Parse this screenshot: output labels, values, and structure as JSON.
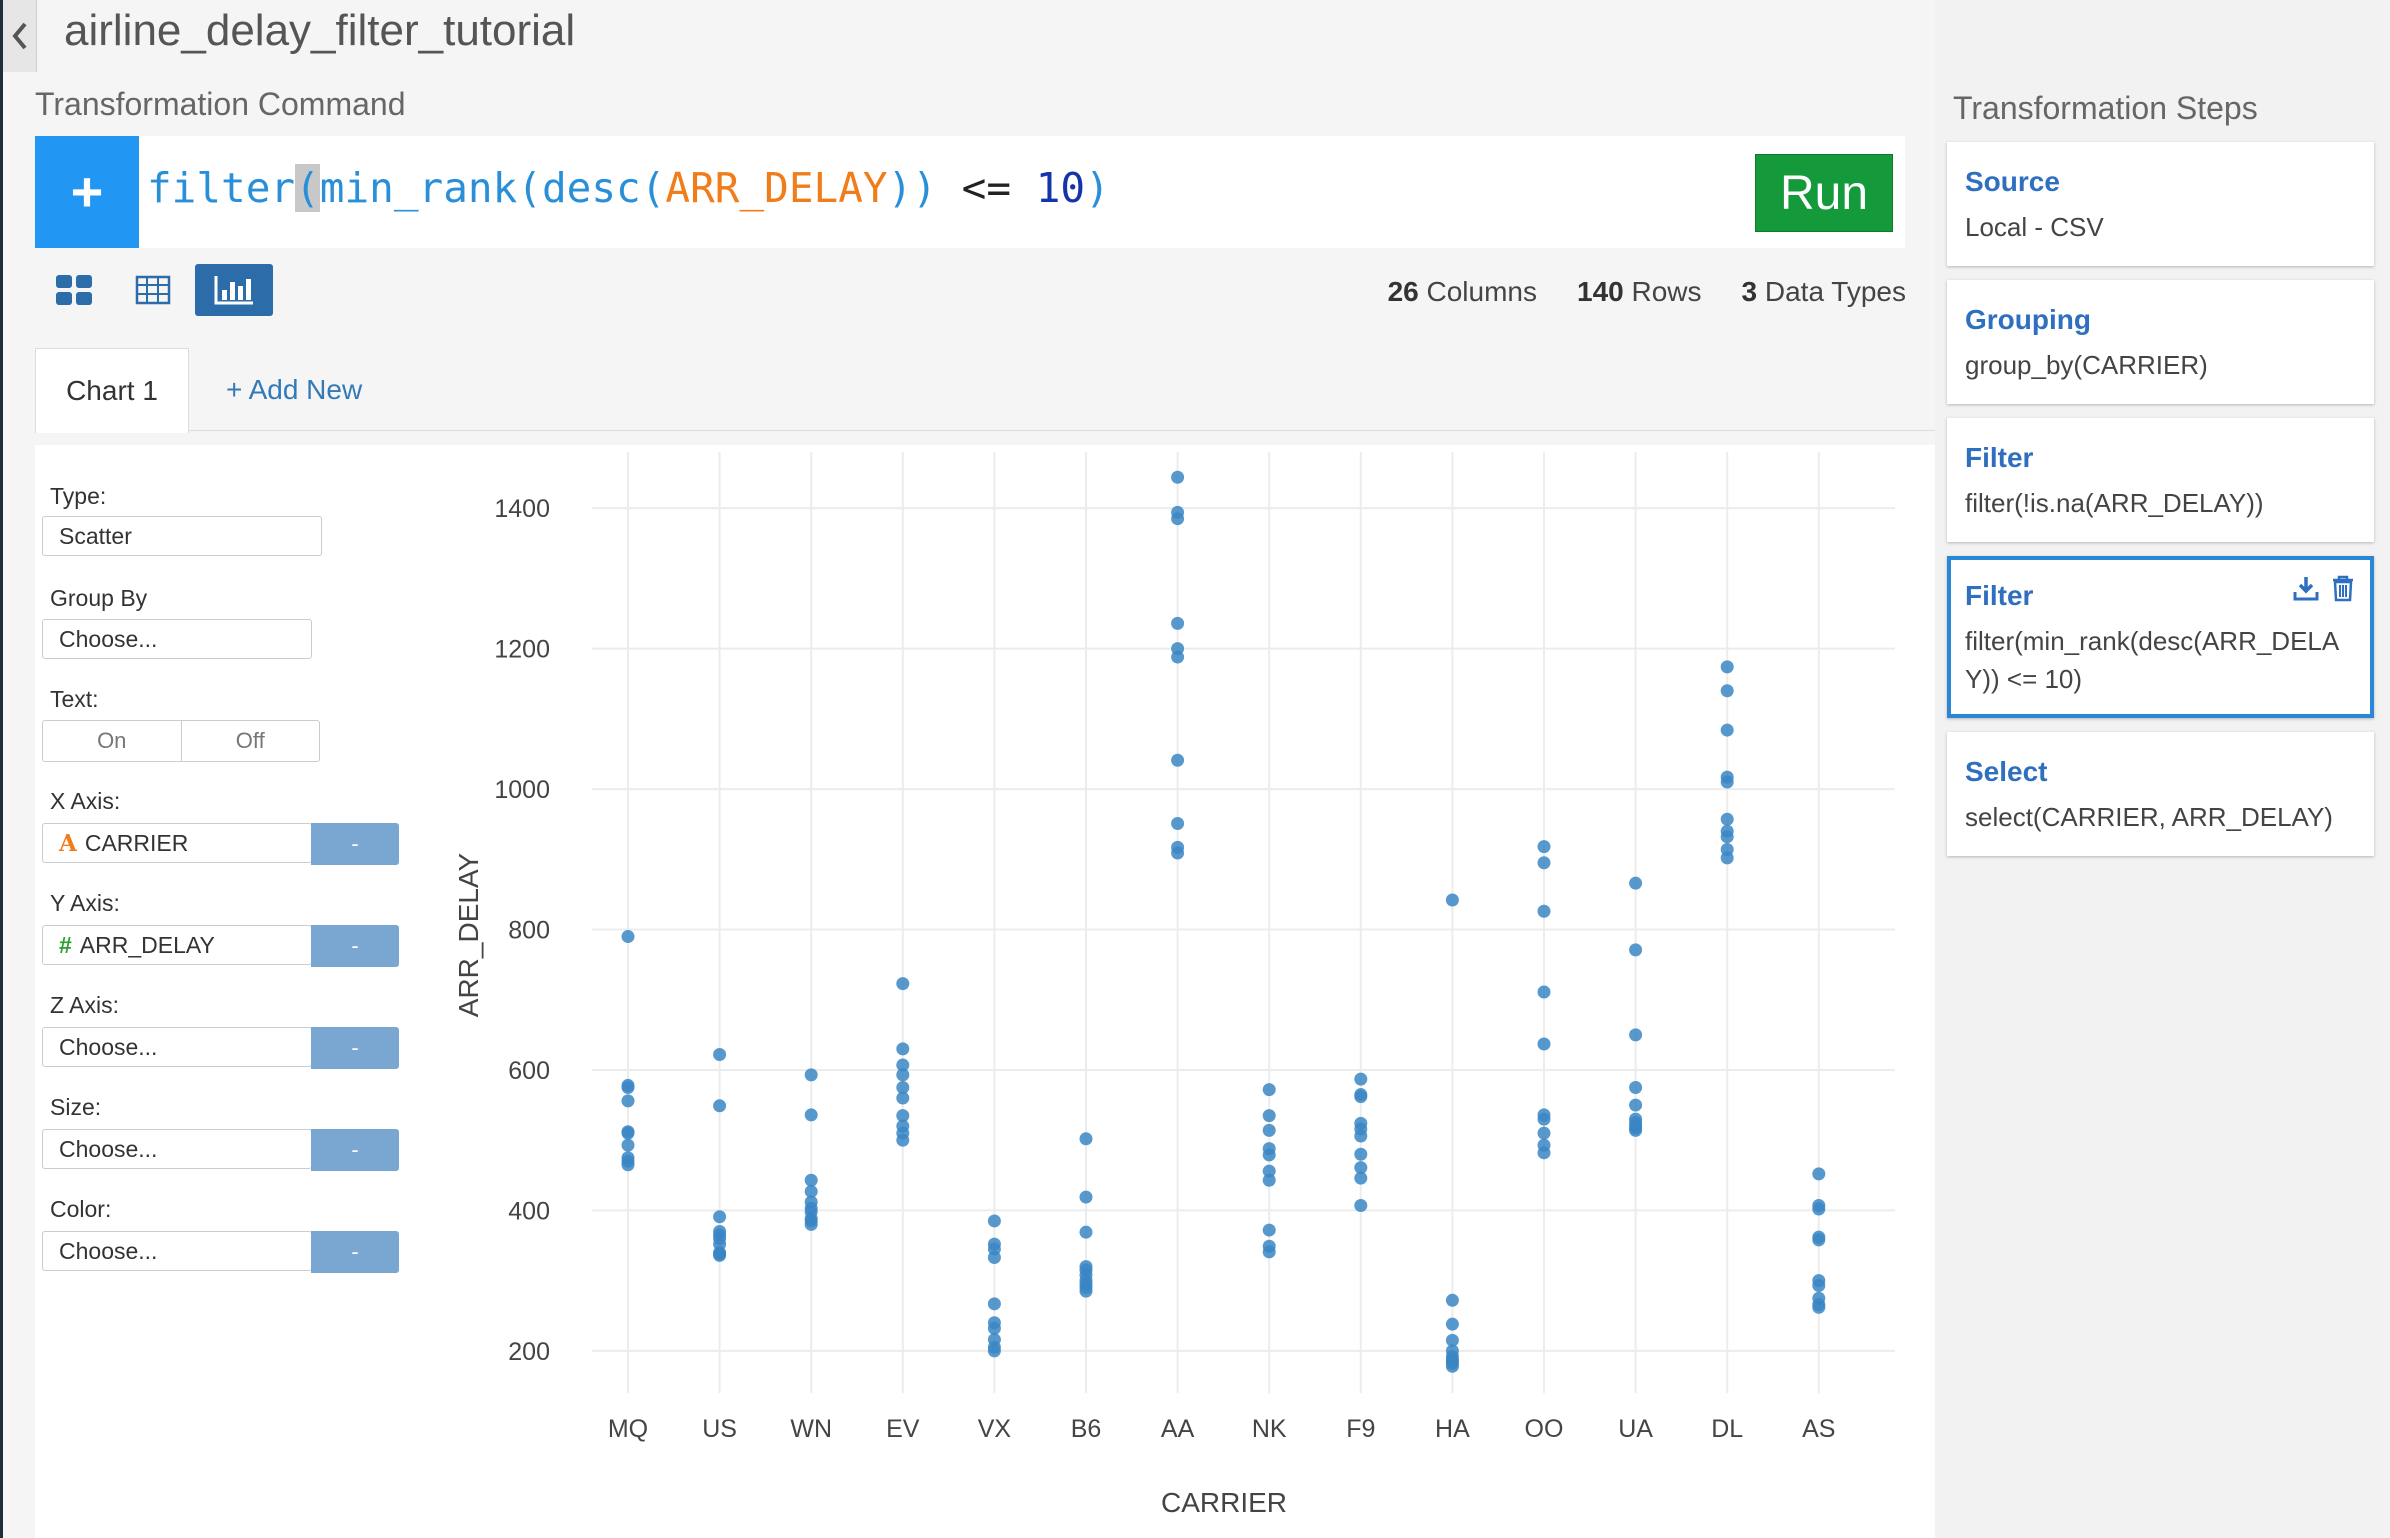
{
  "page": {
    "title": "airline_delay_filter_tutorial"
  },
  "command": {
    "section_label": "Transformation Command",
    "tokens": [
      "filter",
      "(",
      "min_rank",
      "(",
      "desc",
      "(",
      "ARR_DELAY",
      ")",
      ")",
      " <= ",
      "10",
      ")"
    ],
    "run_label": "Run"
  },
  "stats": {
    "columns_count": "26",
    "columns_label": "Columns",
    "rows_count": "140",
    "rows_label": "Rows",
    "types_count": "3",
    "types_label": "Data Types"
  },
  "tabs": {
    "active": "Chart 1",
    "add": "+ Add New"
  },
  "config": {
    "type_label": "Type:",
    "type_value": "Scatter",
    "group_label": "Group By",
    "group_value": "Choose...",
    "text_label": "Text:",
    "text_on": "On",
    "text_off": "Off",
    "x_label": "X Axis:",
    "x_value": "CARRIER",
    "y_label": "Y Axis:",
    "y_value": "ARR_DELAY",
    "z_label": "Z Axis:",
    "z_value": "Choose...",
    "size_label": "Size:",
    "size_value": "Choose...",
    "color_label": "Color:",
    "color_value": "Choose...",
    "minus": "-"
  },
  "steps": {
    "title": "Transformation Steps",
    "items": [
      {
        "name": "Source",
        "cmd": "Local - CSV"
      },
      {
        "name": "Grouping",
        "cmd": "group_by(CARRIER)"
      },
      {
        "name": "Filter",
        "cmd": "filter(!is.na(ARR_DELAY))"
      },
      {
        "name": "Filter",
        "cmd": "filter(min_rank(desc(ARR_DELA Y)) <= 10)"
      },
      {
        "name": "Select",
        "cmd": "select(CARRIER, ARR_DELAY)"
      }
    ]
  },
  "colors": {
    "accent": "#2196f3",
    "run": "#149a3a",
    "point": "#3a86c4"
  },
  "chart_data": {
    "type": "scatter",
    "xlabel": "CARRIER",
    "ylabel": "ARR_DELAY",
    "categories": [
      "MQ",
      "US",
      "WN",
      "EV",
      "VX",
      "B6",
      "AA",
      "NK",
      "F9",
      "HA",
      "OO",
      "UA",
      "DL",
      "AS"
    ],
    "ylim": [
      140,
      1480
    ],
    "yticks": [
      200,
      400,
      600,
      800,
      1000,
      1200,
      1400
    ],
    "grid": true,
    "series": [
      {
        "values": [
          [
            "MQ",
            790
          ],
          [
            "MQ",
            578
          ],
          [
            "MQ",
            575
          ],
          [
            "MQ",
            556
          ],
          [
            "MQ",
            512
          ],
          [
            "MQ",
            510
          ],
          [
            "MQ",
            493
          ],
          [
            "MQ",
            475
          ],
          [
            "MQ",
            470
          ],
          [
            "MQ",
            465
          ],
          [
            "US",
            622
          ],
          [
            "US",
            549
          ],
          [
            "US",
            391
          ],
          [
            "US",
            370
          ],
          [
            "US",
            365
          ],
          [
            "US",
            360
          ],
          [
            "US",
            352
          ],
          [
            "US",
            340
          ],
          [
            "US",
            338
          ],
          [
            "US",
            336
          ],
          [
            "WN",
            593
          ],
          [
            "WN",
            536
          ],
          [
            "WN",
            443
          ],
          [
            "WN",
            427
          ],
          [
            "WN",
            412
          ],
          [
            "WN",
            403
          ],
          [
            "WN",
            398
          ],
          [
            "WN",
            388
          ],
          [
            "WN",
            385
          ],
          [
            "WN",
            380
          ],
          [
            "EV",
            723
          ],
          [
            "EV",
            630
          ],
          [
            "EV",
            607
          ],
          [
            "EV",
            593
          ],
          [
            "EV",
            575
          ],
          [
            "EV",
            560
          ],
          [
            "EV",
            535
          ],
          [
            "EV",
            520
          ],
          [
            "EV",
            510
          ],
          [
            "EV",
            500
          ],
          [
            "VX",
            385
          ],
          [
            "VX",
            352
          ],
          [
            "VX",
            345
          ],
          [
            "VX",
            333
          ],
          [
            "VX",
            267
          ],
          [
            "VX",
            240
          ],
          [
            "VX",
            232
          ],
          [
            "VX",
            216
          ],
          [
            "VX",
            205
          ],
          [
            "VX",
            200
          ],
          [
            "B6",
            502
          ],
          [
            "B6",
            419
          ],
          [
            "B6",
            369
          ],
          [
            "B6",
            320
          ],
          [
            "B6",
            315
          ],
          [
            "B6",
            308
          ],
          [
            "B6",
            300
          ],
          [
            "B6",
            295
          ],
          [
            "B6",
            290
          ],
          [
            "B6",
            285
          ],
          [
            "AA",
            1444
          ],
          [
            "AA",
            1394
          ],
          [
            "AA",
            1385
          ],
          [
            "AA",
            1236
          ],
          [
            "AA",
            1200
          ],
          [
            "AA",
            1188
          ],
          [
            "AA",
            1041
          ],
          [
            "AA",
            951
          ],
          [
            "AA",
            917
          ],
          [
            "AA",
            909
          ],
          [
            "NK",
            572
          ],
          [
            "NK",
            535
          ],
          [
            "NK",
            514
          ],
          [
            "NK",
            488
          ],
          [
            "NK",
            479
          ],
          [
            "NK",
            456
          ],
          [
            "NK",
            443
          ],
          [
            "NK",
            372
          ],
          [
            "NK",
            349
          ],
          [
            "NK",
            341
          ],
          [
            "F9",
            587
          ],
          [
            "F9",
            565
          ],
          [
            "F9",
            562
          ],
          [
            "F9",
            524
          ],
          [
            "F9",
            516
          ],
          [
            "F9",
            506
          ],
          [
            "F9",
            480
          ],
          [
            "F9",
            461
          ],
          [
            "F9",
            446
          ],
          [
            "F9",
            407
          ],
          [
            "HA",
            842
          ],
          [
            "HA",
            272
          ],
          [
            "HA",
            238
          ],
          [
            "HA",
            215
          ],
          [
            "HA",
            200
          ],
          [
            "HA",
            192
          ],
          [
            "HA",
            187
          ],
          [
            "HA",
            185
          ],
          [
            "HA",
            182
          ],
          [
            "HA",
            178
          ],
          [
            "OO",
            918
          ],
          [
            "OO",
            895
          ],
          [
            "OO",
            826
          ],
          [
            "OO",
            711
          ],
          [
            "OO",
            637
          ],
          [
            "OO",
            536
          ],
          [
            "OO",
            530
          ],
          [
            "OO",
            510
          ],
          [
            "OO",
            493
          ],
          [
            "OO",
            482
          ],
          [
            "UA",
            866
          ],
          [
            "UA",
            771
          ],
          [
            "UA",
            650
          ],
          [
            "UA",
            575
          ],
          [
            "UA",
            550
          ],
          [
            "UA",
            530
          ],
          [
            "UA",
            525
          ],
          [
            "UA",
            520
          ],
          [
            "UA",
            517
          ],
          [
            "UA",
            514
          ],
          [
            "DL",
            1174
          ],
          [
            "DL",
            1140
          ],
          [
            "DL",
            1084
          ],
          [
            "DL",
            1017
          ],
          [
            "DL",
            1010
          ],
          [
            "DL",
            957
          ],
          [
            "DL",
            940
          ],
          [
            "DL",
            932
          ],
          [
            "DL",
            914
          ],
          [
            "DL",
            902
          ],
          [
            "AS",
            452
          ],
          [
            "AS",
            407
          ],
          [
            "AS",
            402
          ],
          [
            "AS",
            362
          ],
          [
            "AS",
            358
          ],
          [
            "AS",
            300
          ],
          [
            "AS",
            293
          ],
          [
            "AS",
            275
          ],
          [
            "AS",
            266
          ],
          [
            "AS",
            262
          ]
        ]
      }
    ]
  }
}
